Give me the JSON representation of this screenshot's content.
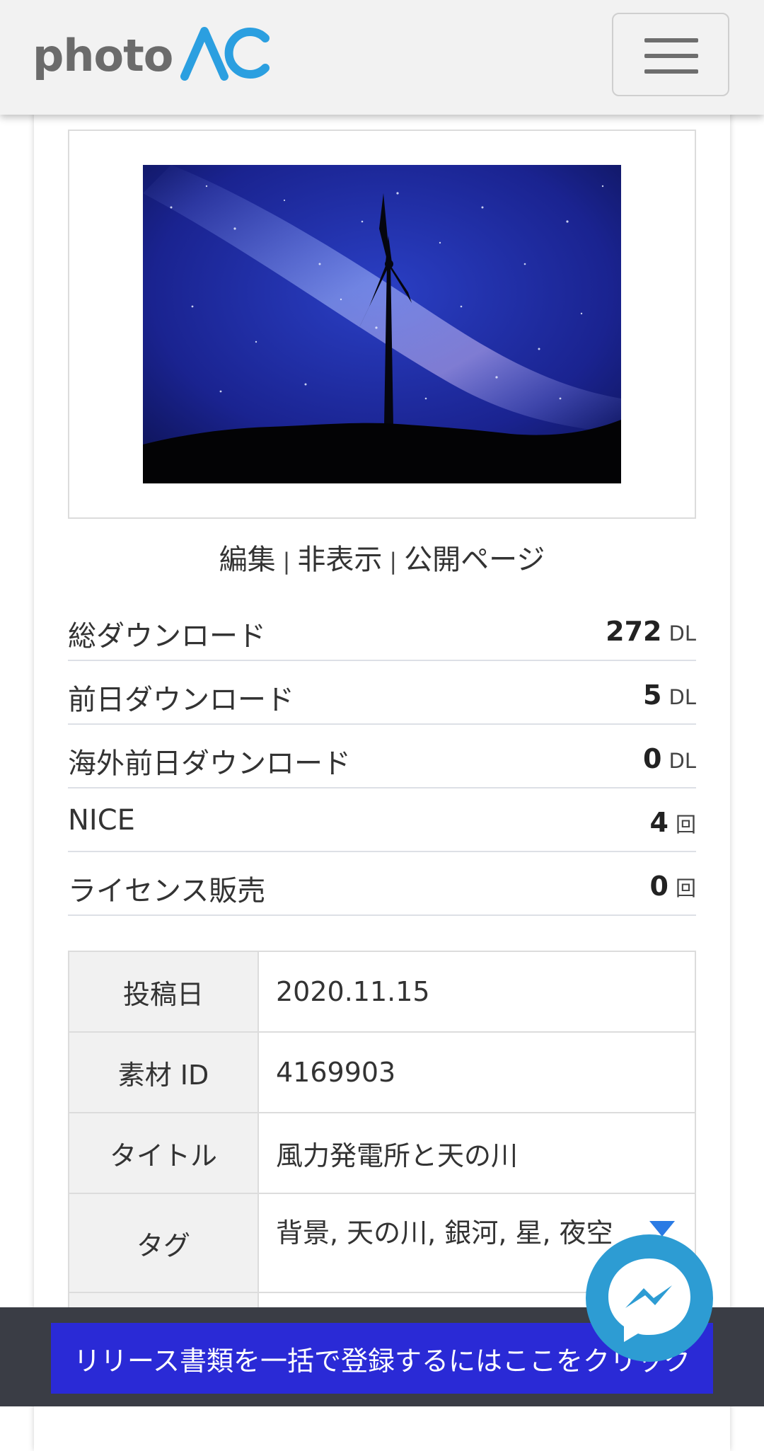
{
  "header": {
    "logo_text_photo": "photo",
    "logo_text_ac": "AC",
    "menu_icon": "hamburger-icon"
  },
  "photo": {
    "description_icon": "image"
  },
  "links": {
    "edit": "編集",
    "hide": "非表示",
    "public_page": "公開ページ",
    "separator": "|"
  },
  "stats": [
    {
      "label": "総ダウンロード",
      "value": "272",
      "unit": "DL"
    },
    {
      "label": "前日ダウンロード",
      "value": "5",
      "unit": "DL"
    },
    {
      "label": "海外前日ダウンロード",
      "value": "0",
      "unit": "DL"
    },
    {
      "label": "NICE",
      "value": "4",
      "unit": "回"
    },
    {
      "label": "ライセンス販売",
      "value": "0",
      "unit": "回"
    }
  ],
  "info": {
    "post_date_label": "投稿日",
    "post_date_value": "2020.11.15",
    "material_id_label": "素材 ID",
    "material_id_value": "4169903",
    "title_label": "タイトル",
    "title_value": "風力発電所と天の川",
    "tags_label": "タグ",
    "tags_value": "背景, 天の川, 銀河, 星, 夜空"
  },
  "bottom": {
    "release_button_label": "リリース書類を一括で登録するにはここをクリック"
  },
  "colors": {
    "accent_blue": "#2b9fe0",
    "button_blue": "#2a2ad6",
    "messenger_blue": "#2d9cd3",
    "bottom_bar": "#3a3d45"
  }
}
